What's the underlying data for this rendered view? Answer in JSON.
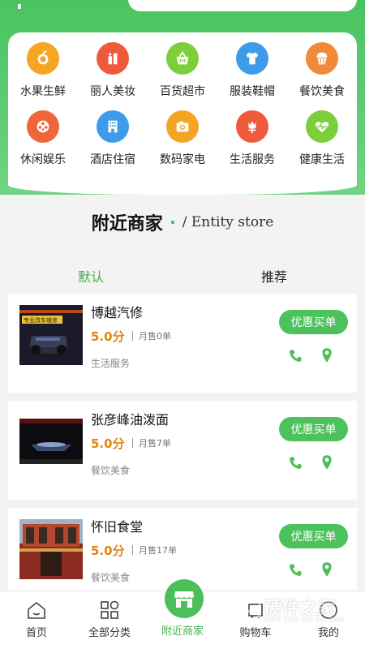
{
  "colors": {
    "brand_green": "#4cbf5a",
    "score_orange": "#e0860f"
  },
  "categories": [
    {
      "label": "水果生鲜",
      "icon": "fruit-icon",
      "color": "#f5a524"
    },
    {
      "label": "丽人美妆",
      "icon": "cosmetics-icon",
      "color": "#ef5a3c"
    },
    {
      "label": "百货超市",
      "icon": "shopping-basket-icon",
      "color": "#7ccf3a"
    },
    {
      "label": "服装鞋帽",
      "icon": "shirt-icon",
      "color": "#3d9be9"
    },
    {
      "label": "餐饮美食",
      "icon": "cupcake-icon",
      "color": "#f08a3a"
    },
    {
      "label": "休闲娱乐",
      "icon": "film-reel-icon",
      "color": "#f0653a"
    },
    {
      "label": "酒店住宿",
      "icon": "building-icon",
      "color": "#3d9be9"
    },
    {
      "label": "数码家电",
      "icon": "camera-icon",
      "color": "#f5a524"
    },
    {
      "label": "生活服务",
      "icon": "flower-icon",
      "color": "#ef5a3c"
    },
    {
      "label": "健康生活",
      "icon": "heartbeat-icon",
      "color": "#7ccf3a"
    }
  ],
  "section": {
    "title_cn": "附近商家",
    "title_en": "/ Entity store"
  },
  "tabs": {
    "default": "默认",
    "recommend": "推荐"
  },
  "stores": [
    {
      "name": "博越汽修",
      "score": "5.0分",
      "sales": "月售0单",
      "category": "生活服务",
      "button": "优惠买单",
      "thumb_text": "专业改车维修"
    },
    {
      "name": "张彦峰油泼面",
      "score": "5.0分",
      "sales": "月售7单",
      "category": "餐饮美食",
      "button": "优惠买单"
    },
    {
      "name": "怀旧食堂",
      "score": "5.0分",
      "sales": "月售17单",
      "category": "餐饮美食",
      "button": "优惠买单"
    }
  ],
  "nav": {
    "home": "首页",
    "all_categories": "全部分类",
    "nearby": "附近商家",
    "cart": "购物车",
    "mine": "我的"
  },
  "watermark": {
    "text": "硬件之家",
    "sub": "YING JIAN ZHI JIA.COM"
  }
}
